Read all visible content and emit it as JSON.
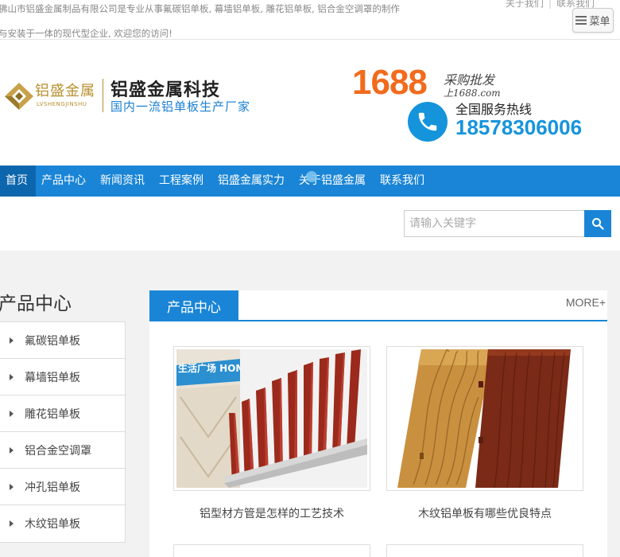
{
  "topbar": {
    "intro": "佛山市铝盛金属制品有限公司是专业从事氟碳铝单板, 幕墙铝单板, 雕花铝单板, 铝合金空调罩的制作与安装于一体的现代型企业, 欢迎您的访问!",
    "links": [
      "关于我们",
      "联系我们"
    ],
    "menu_label": "菜单"
  },
  "header": {
    "logo_cn": "铝盛金属",
    "logo_en": "LVSHENGJINSHU",
    "company_name": "铝盛金属科技",
    "slogan": "国内一流铝单板生产厂家",
    "badge_1688": "1688",
    "badge_text": "采购批发",
    "badge_url": "上1688.com",
    "hotline_label": "全国服务热线",
    "hotline_number": "18578306006"
  },
  "nav": {
    "items": [
      "首页",
      "产品中心",
      "新闻资讯",
      "工程案例",
      "铝盛金属实力",
      "关于铝盛金属",
      "联系我们"
    ],
    "active_index": 0
  },
  "search": {
    "placeholder": "请输入关键字"
  },
  "sidebar": {
    "title": "产品中心",
    "items": [
      "氟碳铝单板",
      "幕墙铝单板",
      "雕花铝单板",
      "铝合金空调罩",
      "冲孔铝单板",
      "木纹铝单板"
    ]
  },
  "panel": {
    "tab_label": "产品中心",
    "more_label": "MORE+",
    "cards": [
      {
        "caption": "铝型材方管是怎样的工艺技术",
        "image_text": "生活广场 HOMETOWN"
      },
      {
        "caption": "木纹铝单板有哪些优良特点"
      }
    ]
  },
  "colors": {
    "brand_blue": "#1a85d6",
    "nav_active": "#0c66ad",
    "accent_orange": "#f26b1d",
    "logo_gold": "#b8902f"
  }
}
